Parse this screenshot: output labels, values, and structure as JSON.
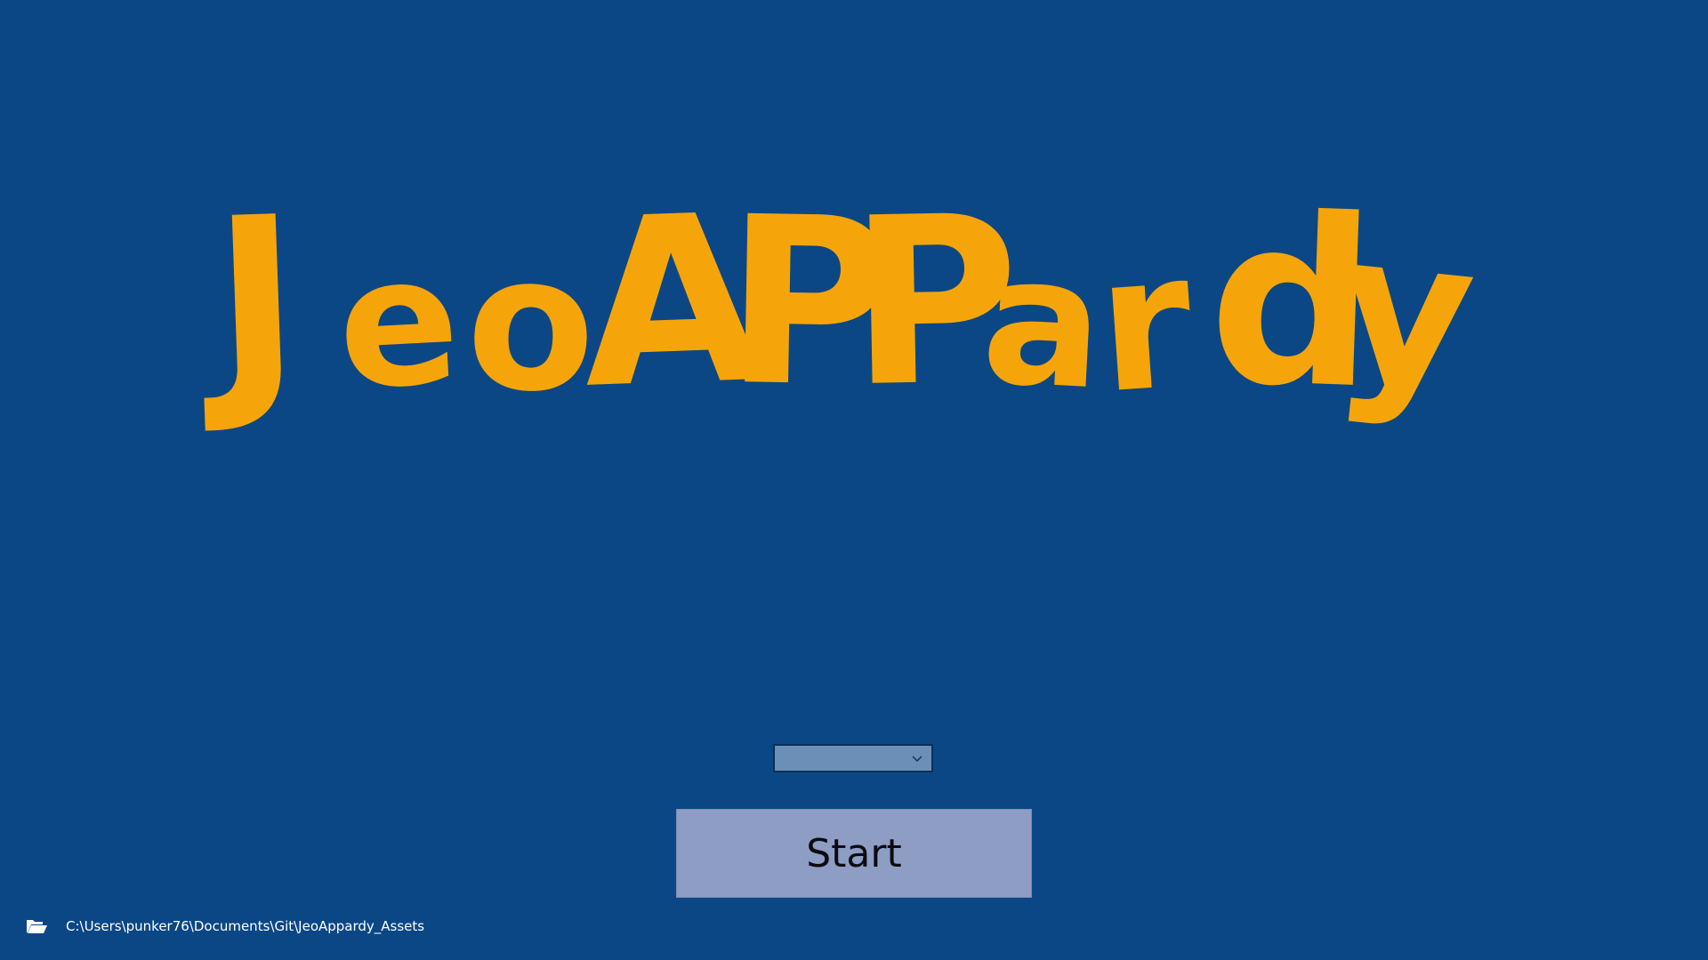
{
  "app": {
    "logo_text": "JeoAPPardy",
    "logo_letters": [
      "J",
      "e",
      "o",
      "A",
      "P",
      "P",
      "a",
      "r",
      "d",
      "y"
    ]
  },
  "colors": {
    "background": "#0b4785",
    "logo": "#f5a50a",
    "start_button": "#8e9dc4",
    "select_box": "#6b8fb6"
  },
  "game_select": {
    "selected_value": "",
    "icon": "chevron-down-icon"
  },
  "start_button": {
    "label": "Start"
  },
  "footer": {
    "folder_icon": "open-folder-icon",
    "path": "C:\\Users\\punker76\\Documents\\Git\\JeoAppardy_Assets"
  }
}
